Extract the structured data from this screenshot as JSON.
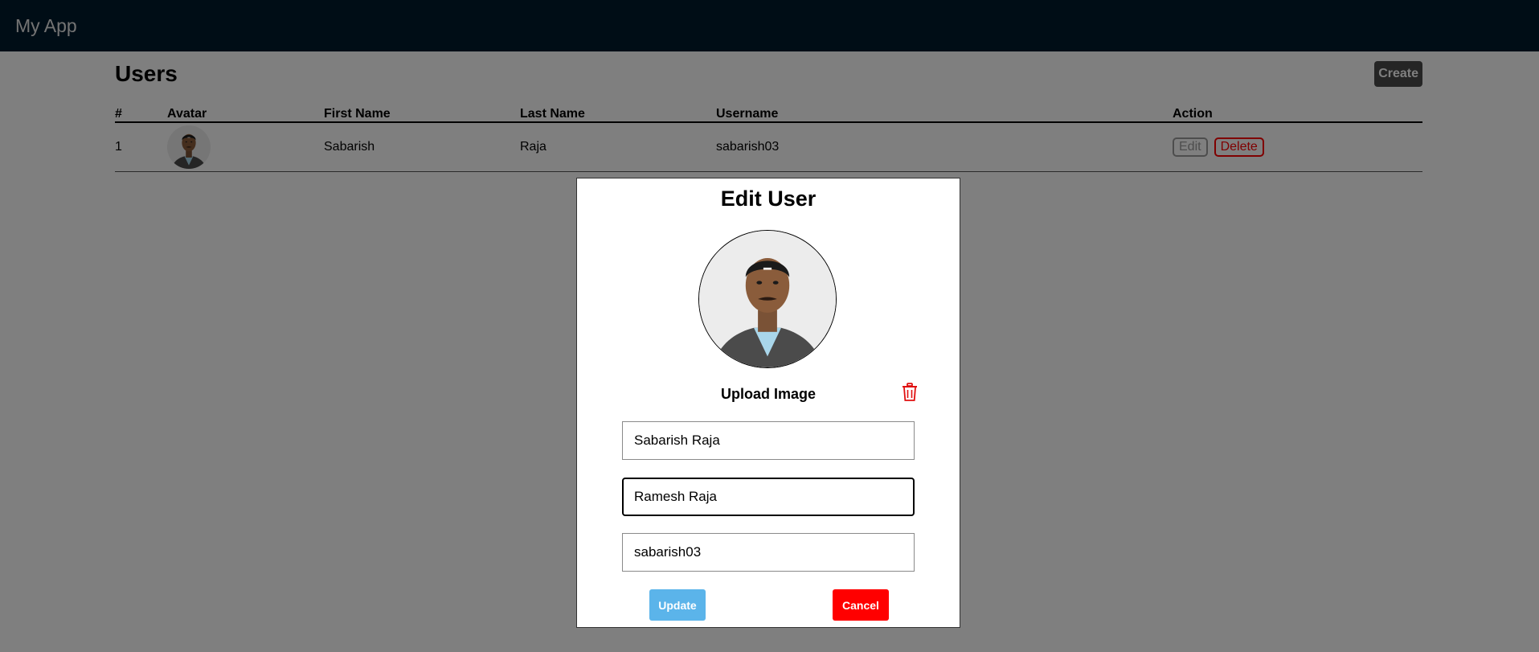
{
  "app": {
    "title": "My App"
  },
  "page": {
    "title": "Users",
    "create_label": "Create"
  },
  "table": {
    "columns": [
      "#",
      "Avatar",
      "First Name",
      "Last Name",
      "Username",
      "Action"
    ],
    "rows": [
      {
        "num": "1",
        "avatar_icon": "user-photo",
        "first_name": "Sabarish",
        "last_name": "Raja",
        "username": "sabarish03",
        "edit_label": "Edit",
        "delete_label": "Delete"
      }
    ]
  },
  "modal": {
    "title": "Edit User",
    "avatar_icon": "user-photo",
    "upload_label": "Upload Image",
    "delete_image_icon": "trash-icon",
    "fields": [
      {
        "value": "Sabarish Raja"
      },
      {
        "value": "Ramesh Raja"
      },
      {
        "value": "sabarish03"
      }
    ],
    "update_label": "Update",
    "cancel_label": "Cancel"
  },
  "colors": {
    "navbar": "#001a2c",
    "update": "#5bb4ea",
    "cancel": "#ff0000",
    "delete": "#ff0000",
    "create": "#4a4a4a"
  }
}
